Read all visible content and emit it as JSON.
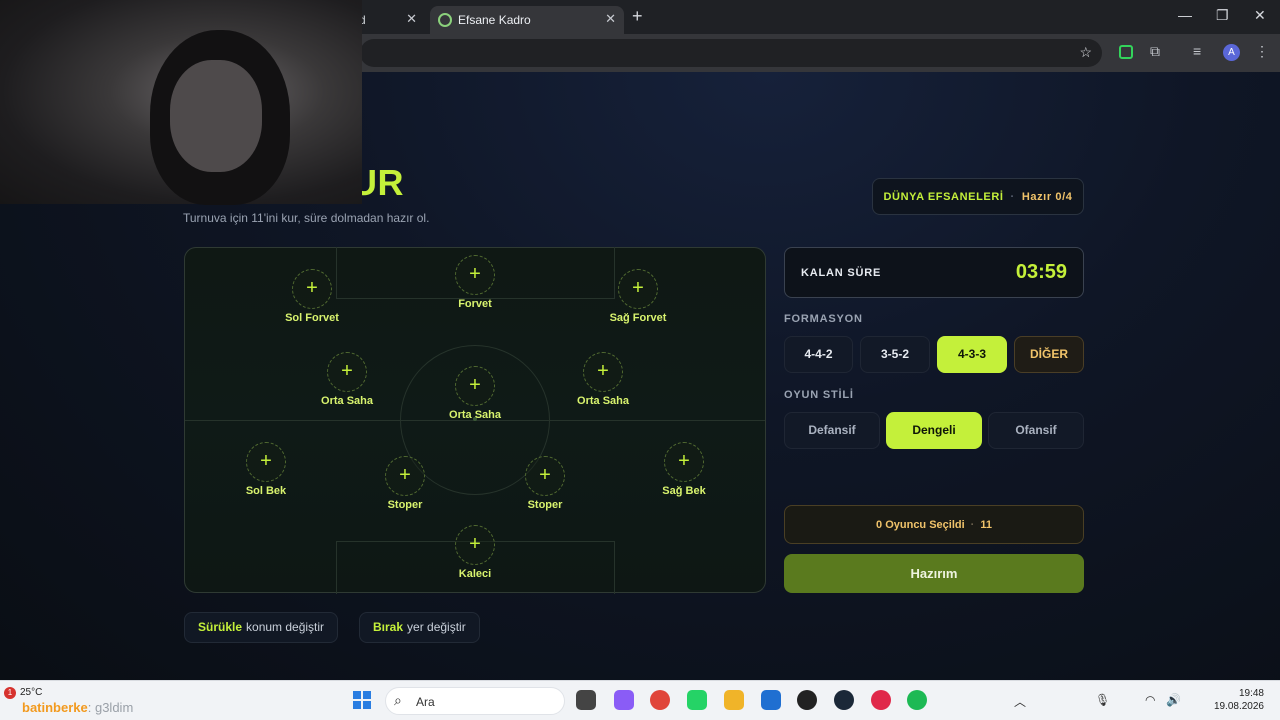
{
  "browser": {
    "tabs": [
      {
        "label": "d"
      },
      {
        "label": "Efsane Kadro"
      }
    ],
    "profile_initial": "A"
  },
  "page": {
    "title": "K 11’İNİ KUR",
    "subtitle": "Turnuva için 11'ini kur, süre dolmadan hazır ol.",
    "mode": {
      "name": "DÜNYA EFSANELERİ",
      "ready": "Hazır 0/4"
    }
  },
  "pitch": {
    "slot_symbol": "+",
    "positions": {
      "forvet": "Forvet",
      "sol_forvet": "Sol Forvet",
      "sag_forvet": "Sağ Forvet",
      "orta_saha_left": "Orta Saha",
      "orta_saha_center": "Orta Saha",
      "orta_saha_right": "Orta Saha",
      "sol_bek": "Sol Bek",
      "stoper_left": "Stoper",
      "stoper_right": "Stoper",
      "sag_bek": "Sağ Bek",
      "kaleci": "Kaleci"
    }
  },
  "timer": {
    "label": "KALAN SÜRE",
    "value": "03:59"
  },
  "formation": {
    "label": "FORMASYON",
    "options": [
      "4-4-2",
      "3-5-2",
      "4-3-3",
      "DİĞER"
    ],
    "selected": "4-3-3"
  },
  "style": {
    "label": "OYUN STİLİ",
    "options": [
      "Defansif",
      "Dengeli",
      "Ofansif"
    ],
    "selected": "Dengeli"
  },
  "selection": {
    "count": "0",
    "text": "Oyuncu Seçildi",
    "separator": "·",
    "total": "11"
  },
  "ready_button": "Hazırım",
  "hints": [
    {
      "key": "Sürükle",
      "text": "konum değiştir"
    },
    {
      "key": "Bırak",
      "text": "yer değiştir"
    }
  ],
  "taskbar": {
    "notification_count": "1",
    "temperature": "25°C",
    "ticker": "batinberke",
    "ticker_tail": ": g3ldim",
    "search_placeholder": "Ara",
    "time": "19:48",
    "date": "19.08.2026"
  },
  "colors": {
    "accent": "#c4f03a",
    "gold": "#f0c36a",
    "ready_button": "#5a7a1e"
  }
}
